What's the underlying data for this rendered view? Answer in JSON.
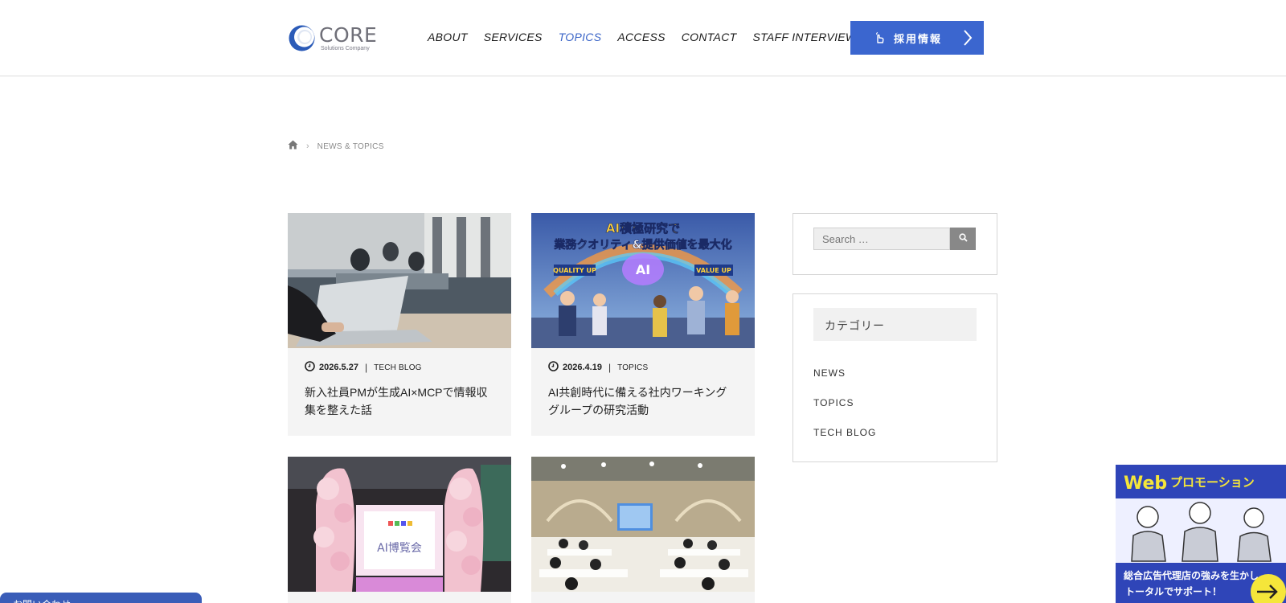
{
  "header": {
    "logo_title": "CORE",
    "logo_sub": "Solutions Company",
    "nav": [
      {
        "label": "ABOUT",
        "active": false
      },
      {
        "label": "SERVICES",
        "active": false
      },
      {
        "label": "TOPICS",
        "active": true
      },
      {
        "label": "ACCESS",
        "active": false
      },
      {
        "label": "CONTACT",
        "active": false
      },
      {
        "label": "STAFF INTERVIEW",
        "active": false
      }
    ],
    "recruit_label": "採用情報"
  },
  "breadcrumb": {
    "home_icon": "home-icon",
    "current": "NEWS & TOPICS"
  },
  "posts": [
    {
      "date": "2026.5.27",
      "category": "TECH BLOG",
      "title": "新入社員PMが生成AI×MCPで情報収集を整えた話"
    },
    {
      "date": "2026.4.19",
      "category": "TOPICS",
      "title": "AI共創時代に備える社内ワーキンググループの研究活動"
    },
    {
      "date": "",
      "category": "",
      "title": ""
    },
    {
      "date": "",
      "category": "",
      "title": ""
    }
  ],
  "thumb_text": {
    "ai_research_line1": "AI積極研究で",
    "ai_research_line2": "業務クオリティ&提供価値を最大化",
    "quality_up": "QUALITY UP",
    "value_up": "VALUE UP",
    "ai_center": "AI",
    "expo_sign": "AI博覧会"
  },
  "sidebar": {
    "search_placeholder": "Search …",
    "category_heading": "カテゴリー",
    "categories": [
      "NEWS",
      "TOPICS",
      "TECH BLOG"
    ]
  },
  "contact_tab": "お問い合わせ",
  "promo": {
    "title_web": "Web",
    "title_rest": "プロモーション",
    "line1": "総合広告代理店の強みを生かし",
    "line2": "トータルでサポート！"
  },
  "colors": {
    "accent": "#3b66cf",
    "card_bg": "#f4f4f4",
    "promo_yellow": "#f5e63a"
  }
}
